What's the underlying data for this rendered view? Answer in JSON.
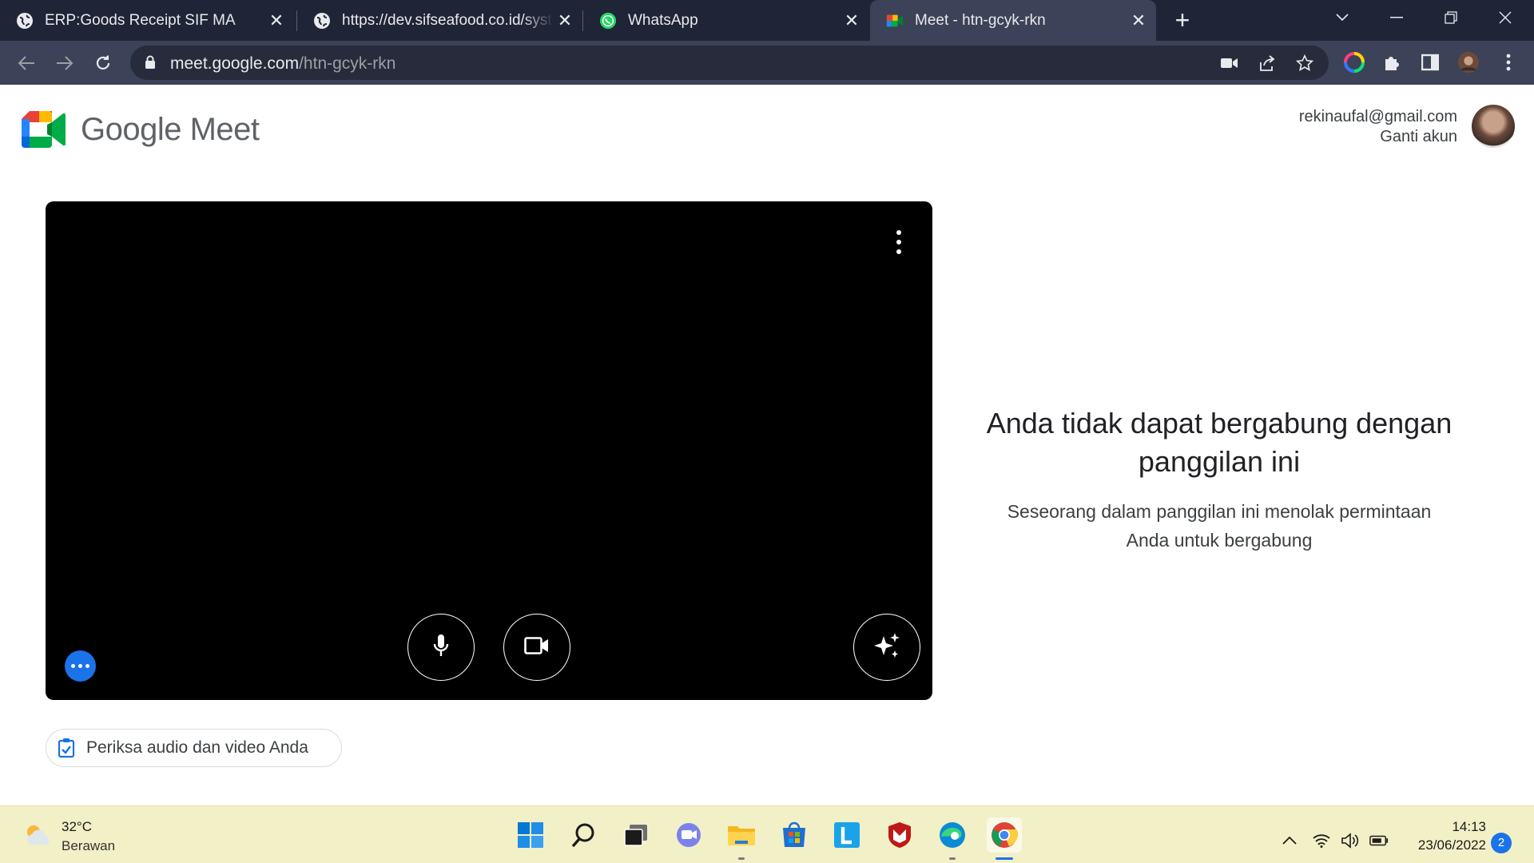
{
  "browser": {
    "tabs": [
      {
        "title": "ERP:Goods Receipt SIF MA",
        "icon": "globe-icon",
        "active": false
      },
      {
        "title": "https://dev.sifseafood.co.id/system/goods-receipt",
        "icon": "globe-icon",
        "active": false
      },
      {
        "title": "WhatsApp",
        "icon": "whatsapp-icon",
        "active": false
      },
      {
        "title": "Meet - htn-gcyk-rkn",
        "icon": "google-meet-icon",
        "active": true
      }
    ],
    "close_glyph": "✕",
    "new_tab_glyph": "+",
    "url": {
      "host": "meet.google.com",
      "path": "/htn-gcyk-rkn"
    }
  },
  "meet": {
    "brand": "Google Meet",
    "account": {
      "email": "rekinaufal@gmail.com",
      "switch_label": "Ganti akun"
    },
    "check_button_label": "Periksa audio dan video Anda",
    "message": {
      "title": "Anda tidak dapat bergabung dengan panggilan ini",
      "subtitle": "Seseorang dalam panggilan ini menolak permintaan Anda untuk bergabung"
    }
  },
  "taskbar": {
    "weather": {
      "temp": "32°C",
      "desc": "Berawan"
    },
    "clock": {
      "time": "14:13",
      "date": "23/06/2022"
    },
    "notifications": "2"
  },
  "colors": {
    "accent": "#1a73e8",
    "tabstrip": "#202437",
    "toolbar": "#3c4257",
    "taskbar": "#f2f0c6"
  }
}
